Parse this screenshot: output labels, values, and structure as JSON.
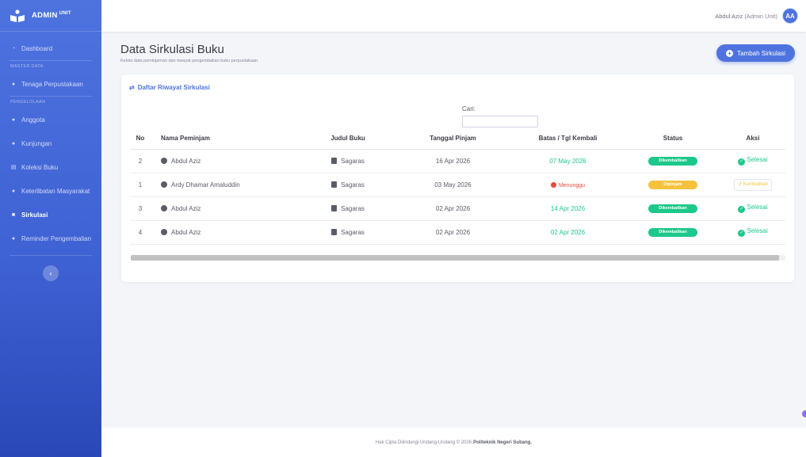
{
  "brand": {
    "name": "ADMIN",
    "suffix": "UNIT"
  },
  "sidebar": {
    "items": [
      {
        "label": "Dashboard",
        "icon": "dashboard-icon"
      },
      {
        "section": "MASTER DATA"
      },
      {
        "label": "Tenaga Perpustakaan",
        "icon": "user-icon"
      },
      {
        "section": "PENGELOLAAN"
      },
      {
        "label": "Anggota",
        "icon": "users-icon"
      },
      {
        "label": "Kunjungan",
        "icon": "visit-icon"
      },
      {
        "label": "Koleksi Buku",
        "icon": "book-icon"
      },
      {
        "label": "Keterlibatan Masyarakat",
        "icon": "community-icon"
      },
      {
        "label": "Sirkulasi",
        "icon": "circulation-icon",
        "active": true
      },
      {
        "label": "Reminder Pengembalian",
        "icon": "bell-icon"
      }
    ],
    "toggle": "‹"
  },
  "topbar": {
    "user_name": "Abdul Aziz",
    "user_role": "(Admin Unit)",
    "avatar_text": "AA"
  },
  "page": {
    "title": "Data Sirkulasi Buku",
    "subtitle": "Kelola data peminjaman dan riwayat pengembalian buku perpustakaan.",
    "add_button": "Tambah Sirkulasi"
  },
  "card": {
    "title": "Daftar Riwayat Sirkulasi",
    "search_label": "Cari:",
    "search_value": ""
  },
  "table": {
    "headers": [
      "No",
      "Nama Peminjam",
      "Judul Buku",
      "Tanggal Pinjam",
      "Batas / Tgl Kembali",
      "Status",
      "Aksi"
    ],
    "rows": [
      {
        "no": "2",
        "nama": "Abdul Aziz",
        "judul": "Sagaras",
        "tgl_pinjam": "16 Apr 2026",
        "batas": "07 May 2026",
        "status": "Dikembalikan",
        "aksi": "Selesai"
      },
      {
        "no": "1",
        "nama": "Ardy Dhamar Amaluddin",
        "judul": "Sagaras",
        "tgl_pinjam": "03 May 2026",
        "batas": "Menunggu",
        "status": "Dipinjam",
        "aksi": "Kembalikan"
      },
      {
        "no": "3",
        "nama": "Abdul Aziz",
        "judul": "Sagaras",
        "tgl_pinjam": "02 Apr 2026",
        "batas": "14 Apr 2026",
        "status": "Dikembalikan",
        "aksi": "Selesai"
      },
      {
        "no": "4",
        "nama": "Abdul Aziz",
        "judul": "Sagaras",
        "tgl_pinjam": "02 Apr 2026",
        "batas": "02 Apr 2026",
        "status": "Dikembalikan",
        "aksi": "Selesai"
      }
    ]
  },
  "footer": {
    "text": "Hak Cipta Dilindungi Undang-Undang © 2026",
    "org": "Politeknik Negeri Subang."
  },
  "colors": {
    "primary": "#4e73df",
    "success": "#1cc88a",
    "warning": "#f6c23e",
    "danger": "#e74a3b"
  }
}
